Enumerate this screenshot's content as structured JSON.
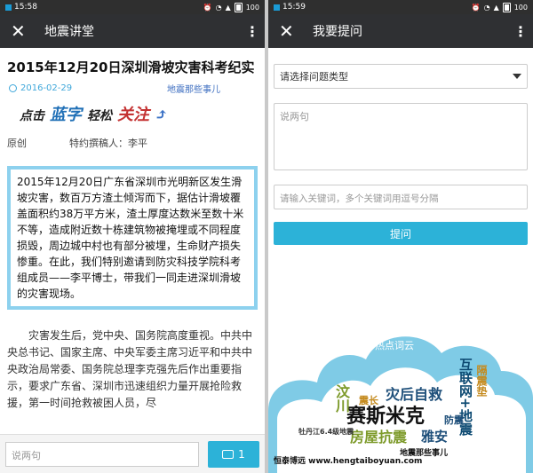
{
  "left": {
    "status": {
      "time": "15:58",
      "battery": "100"
    },
    "appbar": {
      "title": "地震讲堂"
    },
    "article": {
      "title": "2015年12月20日深圳滑坡灾害科考纪实",
      "date": "2016-02-29",
      "account": "地震那些事儿",
      "banner": {
        "part1": "点击",
        "part2": "蓝字",
        "part3": "轻松",
        "part4": "关注"
      },
      "original": "原创",
      "author": "特约撰稿人：李平",
      "quote": "2015年12月20日广东省深圳市光明新区发生滑坡灾害，数百万方渣土倾泻而下，据估计滑坡覆盖面积约38万平方米，渣土厚度达数米至数十米不等，造成附近数十栋建筑物被掩埋或不同程度损毁，周边城中村也有部分被埋，生命财产损失惨重。在此，我们特别邀请到防灾科技学院科考组成员——李平博士，带我们一同走进深圳滑坡的灾害现场。",
      "body": "灾害发生后，党中央、国务院高度重视。中共中央总书记、国家主席、中央军委主席习近平和中共中央政治局常委、国务院总理李克强先后作出重要指示，要求广东省、深圳市迅速组织力量开展抢险救援，第一时间抢救被困人员，尽"
    },
    "comment": {
      "placeholder": "说两句",
      "count": "1"
    }
  },
  "right": {
    "status": {
      "time": "15:59",
      "battery": "100"
    },
    "appbar": {
      "title": "我要提问"
    },
    "form": {
      "select_label": "请选择问题类型",
      "textarea_placeholder": "说两句",
      "keywords_placeholder": "请输入关键词，多个关键词用逗号分隔",
      "submit_label": "提问"
    },
    "tagcloud": {
      "title": "热点词云",
      "words": [
        "赛斯米克",
        "灾后自救",
        "互联网+地震",
        "房屋抗震",
        "汶川",
        "雅安",
        "震长",
        "隔震垫",
        "地震那些事儿",
        "牡丹江6.4级地震",
        "防震"
      ],
      "watermark": "恒泰博远 www.hengtaiboyuan.com"
    },
    "colors": {
      "accent": "#2cb2d8",
      "cloud": "#7fcbe6"
    }
  }
}
